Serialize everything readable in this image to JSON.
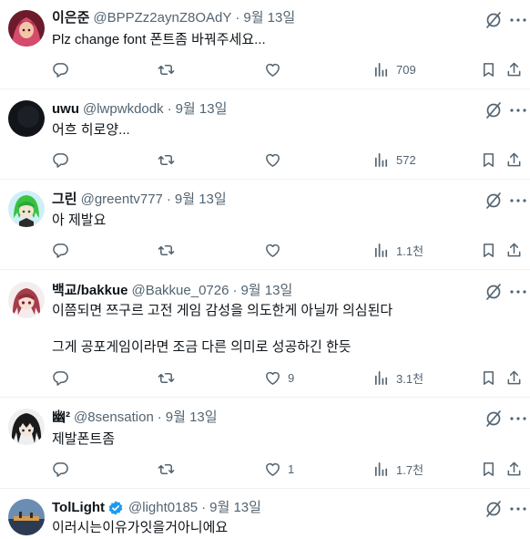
{
  "tweets": [
    {
      "name": "이은준",
      "handle": "@BPPZz2aynZ8OAdY",
      "separator": "·",
      "date": "9월 13일",
      "verified": false,
      "lines": [
        "Plz change font 폰트좀 바꿔주세요..."
      ],
      "reply_count": "",
      "retweet_count": "",
      "like_count": "",
      "views": "709",
      "avatar_colors": [
        "#6b1b2a",
        "#d64a6b",
        "#f2c7a8"
      ]
    },
    {
      "name": "uwu",
      "handle": "@lwpwkdodk",
      "separator": "·",
      "date": "9월 13일",
      "verified": false,
      "lines": [
        "어흐 히로양..."
      ],
      "reply_count": "",
      "retweet_count": "",
      "like_count": "",
      "views": "572",
      "avatar_colors": [
        "#111418",
        "#23272d",
        "#111418"
      ]
    },
    {
      "name": "그린",
      "handle": "@greentv777",
      "separator": "·",
      "date": "9월 13일",
      "verified": false,
      "lines": [
        "아 제발요"
      ],
      "reply_count": "",
      "retweet_count": "",
      "like_count": "",
      "views": "1.1천",
      "avatar_colors": [
        "#cfeff7",
        "#39c241",
        "#f4e3d2"
      ]
    },
    {
      "name": "백교/bakkue",
      "handle": "@Bakkue_0726",
      "separator": "·",
      "date": "9월 13일",
      "verified": false,
      "lines": [
        "이쯤되면 쯔구르 고전 게임 감성을 의도한게 아닐까 의심된다",
        "그게 공포게임이라면 조금 다른 의미로 성공하긴 한듯"
      ],
      "reply_count": "",
      "retweet_count": "",
      "like_count": "9",
      "views": "3.1천",
      "avatar_colors": [
        "#f5eded",
        "#a63d4a",
        "#f7dfd6"
      ]
    },
    {
      "name": "幽²",
      "handle": "@8sensation",
      "separator": "·",
      "date": "9월 13일",
      "verified": false,
      "lines": [
        "제발폰트좀"
      ],
      "reply_count": "",
      "retweet_count": "",
      "like_count": "1",
      "views": "1.7천",
      "avatar_colors": [
        "#efefef",
        "#1a1a1a",
        "#f4e6dc"
      ]
    },
    {
      "name": "TolLight",
      "handle": "@light0185",
      "separator": "·",
      "date": "9월 13일",
      "verified": true,
      "lines": [
        "이러시는이유가잇을거아니에요"
      ],
      "reply_count": "",
      "retweet_count": "",
      "like_count": "",
      "views": "",
      "avatar_colors": [
        "#6c8db2",
        "#2c3b52",
        "#d89a4c"
      ]
    }
  ],
  "icons": {
    "grok": "grok-icon",
    "more": "more-icon",
    "reply": "reply-icon",
    "retweet": "retweet-icon",
    "like": "like-icon",
    "views": "views-icon",
    "bookmark": "bookmark-icon",
    "share": "share-icon",
    "verified": "verified-badge-icon"
  },
  "colors": {
    "text": "#0f1419",
    "secondary": "#536471",
    "divider": "#eff3f4",
    "verified": "#1d9bf0"
  }
}
